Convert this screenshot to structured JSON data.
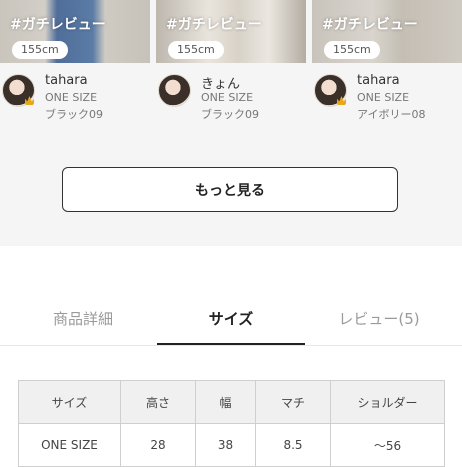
{
  "reviews": [
    {
      "tag": "#ガチレビュー",
      "height": "155cm",
      "username": "tahara",
      "size": "ONE SIZE",
      "color": "ブラック09",
      "crown": true
    },
    {
      "tag": "#ガチレビュー",
      "height": "155cm",
      "username": "きょん",
      "size": "ONE SIZE",
      "color": "ブラック09",
      "crown": false
    },
    {
      "tag": "#ガチレビュー",
      "height": "155cm",
      "username": "tahara",
      "size": "ONE SIZE",
      "color": "アイボリー08",
      "crown": true
    }
  ],
  "more_button": {
    "label": "もっと見る"
  },
  "tabs": [
    {
      "label": "商品詳細",
      "active": false
    },
    {
      "label": "サイズ",
      "active": true
    },
    {
      "label": "レビュー(5)",
      "active": false
    }
  ],
  "size_table": {
    "headers": [
      "サイズ",
      "高さ",
      "幅",
      "マチ",
      "ショルダー"
    ],
    "rows": [
      [
        "ONE SIZE",
        "28",
        "38",
        "8.5",
        "〜56"
      ]
    ]
  },
  "colors": {
    "section_bg": "#f5f5f5",
    "active_tab": "#222222",
    "inactive_tab": "#9a9a9a",
    "crown": "#e6a817"
  }
}
